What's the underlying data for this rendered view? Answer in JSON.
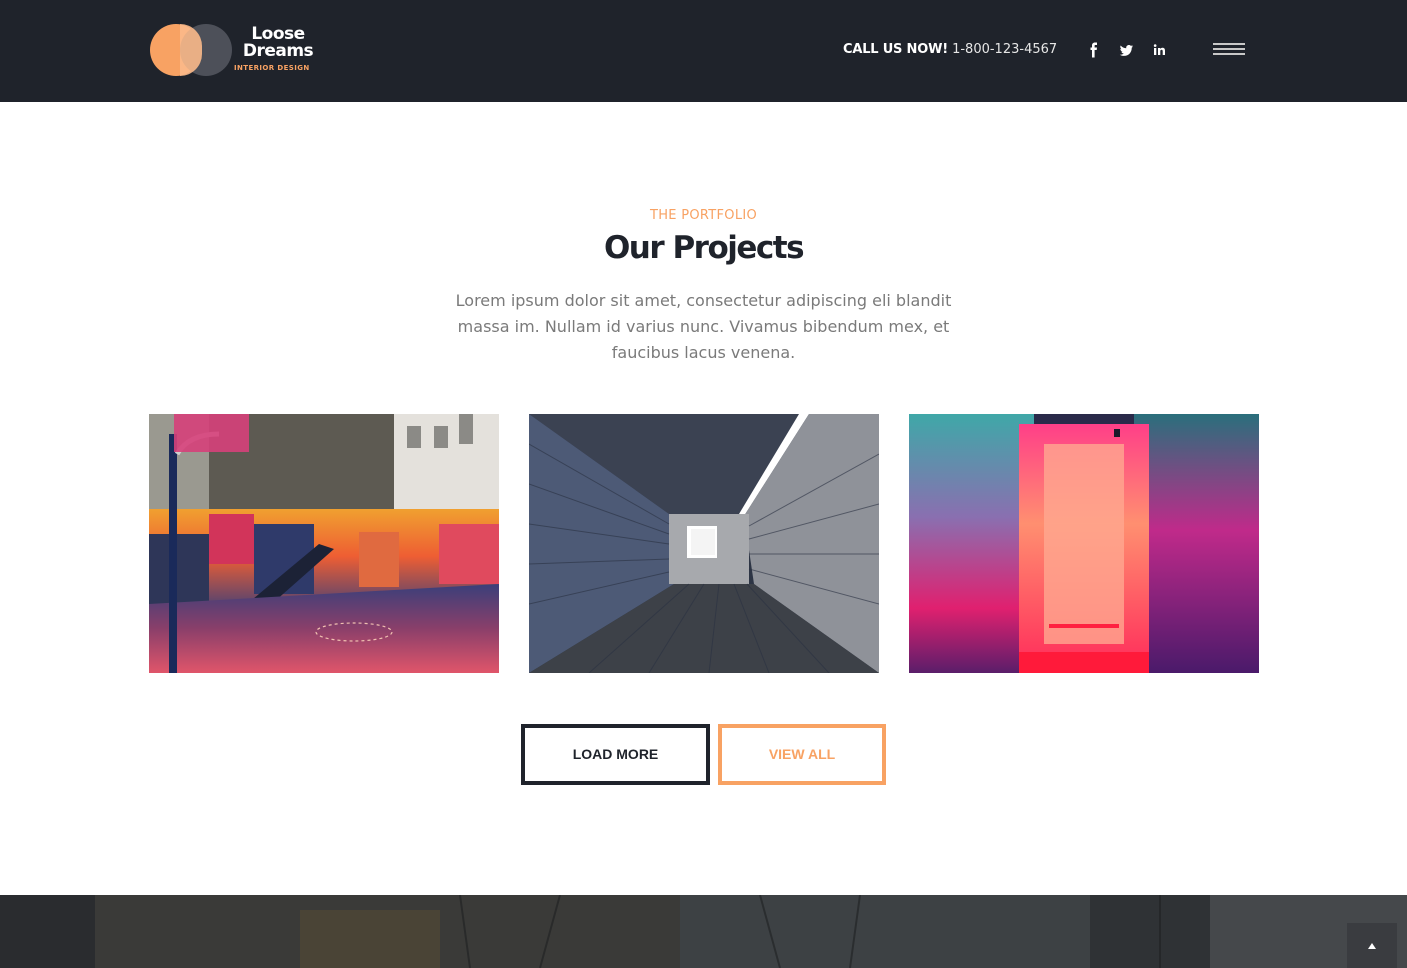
{
  "header": {
    "logo": {
      "line1": "Loose",
      "line2": "Dreams",
      "tagline": "INTERIOR DESIGN"
    },
    "call_label": "CALL US NOW!",
    "phone": "1-800-123-4567",
    "social": [
      {
        "name": "facebook-icon",
        "glyph": "f"
      },
      {
        "name": "twitter-icon",
        "glyph": "t"
      },
      {
        "name": "linkedin-icon",
        "glyph": "in"
      }
    ],
    "menu_icon": "hamburger-menu-icon"
  },
  "portfolio": {
    "eyebrow": "THE PORTFOLIO",
    "title": "Our Projects",
    "description": "Lorem ipsum dolor sit amet, consectetur adipiscing eli blandit massa im. Nullam id varius nunc. Vivamus bibendum mex, et faucibus lacus venena.",
    "projects": [
      {
        "name": "project-basketball-court"
      },
      {
        "name": "project-wooden-corridor"
      },
      {
        "name": "project-neon-hallway"
      }
    ],
    "load_more_label": "LOAD MORE",
    "view_all_label": "VIEW ALL"
  },
  "back_to_top_icon": "chevron-up-icon",
  "colors": {
    "accent": "#f8a263",
    "dark": "#1f232b",
    "text_muted": "#7a7a7a"
  }
}
